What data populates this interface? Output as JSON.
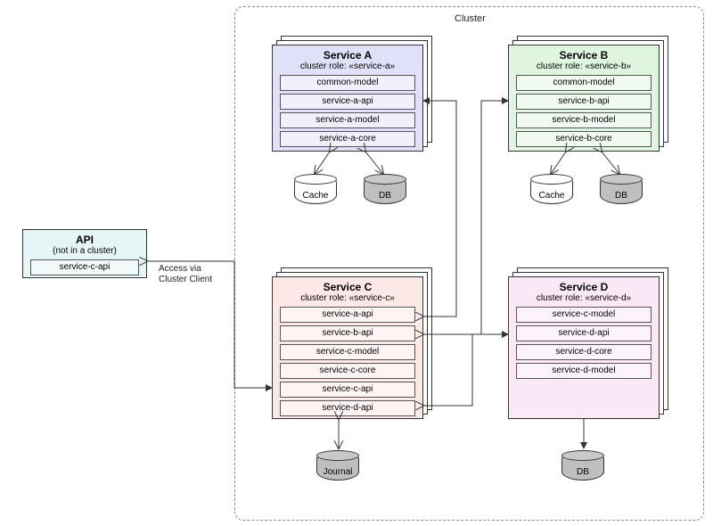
{
  "cluster_label": "Cluster",
  "access_label": "Access via\nCluster Client",
  "api": {
    "title": "API",
    "subtitle": "(not in a cluster)",
    "mods": [
      "service-c-api"
    ]
  },
  "services": {
    "a": {
      "title": "Service A",
      "subtitle": "cluster role: «service-a»",
      "mods": [
        "common-model",
        "service-a-api",
        "service-a-model",
        "service-a-core"
      ],
      "stores": {
        "cache": "Cache",
        "db": "DB"
      }
    },
    "b": {
      "title": "Service B",
      "subtitle": "cluster role: «service-b»",
      "mods": [
        "common-model",
        "service-b-api",
        "service-b-model",
        "service-b-core"
      ],
      "stores": {
        "cache": "Cache",
        "db": "DB"
      }
    },
    "c": {
      "title": "Service C",
      "subtitle": "cluster role: «service-c»",
      "mods": [
        "service-a-api",
        "service-b-api",
        "service-c-model",
        "service-c-core",
        "service-c-api",
        "service-d-api"
      ],
      "stores": {
        "journal": "Journal"
      }
    },
    "d": {
      "title": "Service D",
      "subtitle": "cluster role: «service-d»",
      "mods": [
        "service-c-model",
        "service-d-api",
        "service-d-core",
        "service-d-model"
      ],
      "stores": {
        "db": "DB"
      }
    }
  },
  "chart_data": {
    "type": "diagram",
    "title": "Cluster service topology",
    "nodes": [
      {
        "id": "api",
        "label": "API",
        "role": "(not in a cluster)",
        "in_cluster": false,
        "mods": [
          "service-c-api"
        ]
      },
      {
        "id": "service-a",
        "label": "Service A",
        "role": "cluster role: «service-a»",
        "in_cluster": true,
        "mods": [
          "common-model",
          "service-a-api",
          "service-a-model",
          "service-a-core"
        ],
        "stores": [
          "Cache",
          "DB"
        ]
      },
      {
        "id": "service-b",
        "label": "Service B",
        "role": "cluster role: «service-b»",
        "in_cluster": true,
        "mods": [
          "common-model",
          "service-b-api",
          "service-b-model",
          "service-b-core"
        ],
        "stores": [
          "Cache",
          "DB"
        ]
      },
      {
        "id": "service-c",
        "label": "Service C",
        "role": "cluster role: «service-c»",
        "in_cluster": true,
        "mods": [
          "service-a-api",
          "service-b-api",
          "service-c-model",
          "service-c-core",
          "service-c-api",
          "service-d-api"
        ],
        "stores": [
          "Journal"
        ]
      },
      {
        "id": "service-d",
        "label": "Service D",
        "role": "cluster role: «service-d»",
        "in_cluster": true,
        "mods": [
          "service-c-model",
          "service-d-api",
          "service-d-core",
          "service-d-model"
        ],
        "stores": [
          "DB"
        ]
      }
    ],
    "edges": [
      {
        "from": "api",
        "to": "service-c",
        "via": "service-c-api",
        "note": "Access via Cluster Client"
      },
      {
        "from": "service-c",
        "to": "service-a",
        "via": "service-a-api"
      },
      {
        "from": "service-c",
        "to": "service-b",
        "via": "service-b-api"
      },
      {
        "from": "service-c",
        "to": "service-d",
        "via": "service-d-api"
      },
      {
        "from": "service-d",
        "to": "service-c",
        "via": "service-c-model"
      },
      {
        "from": "service-a",
        "to": "Cache",
        "via": "store",
        "bidirectional": true
      },
      {
        "from": "service-a",
        "to": "DB",
        "via": "store",
        "bidirectional": true
      },
      {
        "from": "service-b",
        "to": "Cache",
        "via": "store",
        "bidirectional": true
      },
      {
        "from": "service-b",
        "to": "DB",
        "via": "store",
        "bidirectional": true
      },
      {
        "from": "service-c",
        "to": "Journal",
        "via": "store",
        "bidirectional": true
      },
      {
        "from": "service-d",
        "to": "DB",
        "via": "store",
        "bidirectional": false
      }
    ]
  }
}
